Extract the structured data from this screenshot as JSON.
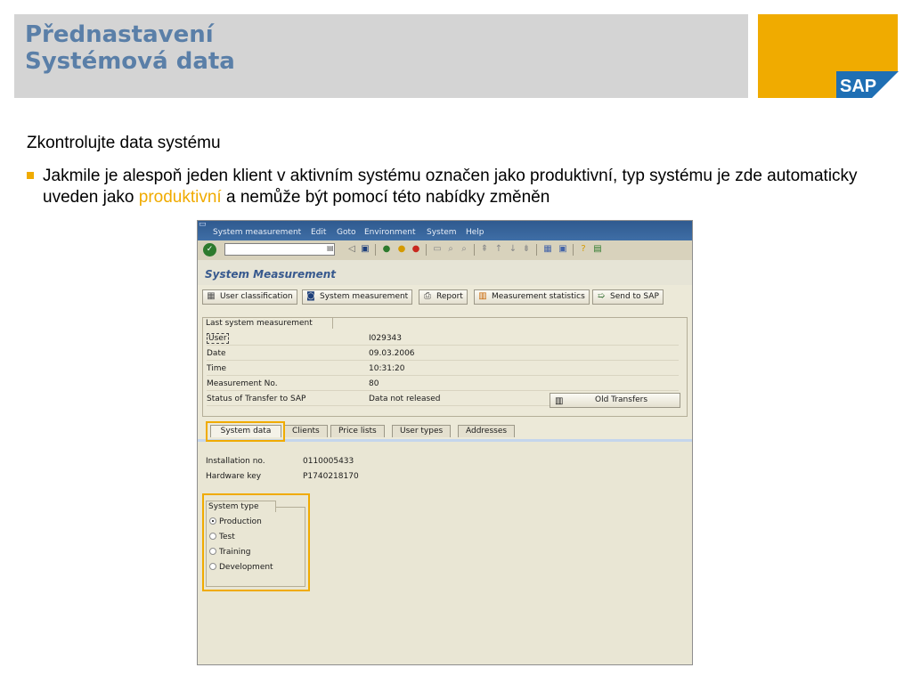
{
  "slide": {
    "title_line1": "Přednastavení",
    "title_line2": "Systémová data",
    "subheading": "Zkontrolujte data systému",
    "bullet_before": "Jakmile je alespoň jeden klient v aktivním systému označen jako produktivní, typ systému je zde automaticky uveden jako ",
    "bullet_highlight": "produktivní",
    "bullet_after": " a nemůže být pomocí této nabídky změněn",
    "logo_text": "SAP",
    "colors": {
      "accent": "#f0ab00",
      "title": "#5a7fa8",
      "header_bg": "#d4d4d4"
    }
  },
  "sap_window": {
    "menu": [
      "System measurement",
      "Edit",
      "Goto",
      "Environment",
      "System",
      "Help"
    ],
    "toolbar_icons": [
      "enter-icon",
      "command-field",
      "back-icon",
      "save-icon",
      "back-nav-icon",
      "exit-icon",
      "cancel-icon",
      "print-icon",
      "find-icon",
      "find-next-icon",
      "first-page-icon",
      "prev-page-icon",
      "next-page-icon",
      "last-page-icon",
      "new-session-icon",
      "shortcut-icon",
      "help-icon",
      "layout-icon"
    ],
    "screen_title": "System Measurement",
    "app_buttons": [
      {
        "label": "User classification",
        "icon": "grid-icon"
      },
      {
        "label": "System measurement",
        "icon": "measure-icon"
      },
      {
        "label": "Report",
        "icon": "print-icon"
      },
      {
        "label": "Measurement statistics",
        "icon": "chart-icon"
      },
      {
        "label": "Send to SAP",
        "icon": "send-icon"
      }
    ],
    "last_measurement": {
      "group_title": "Last system measurement",
      "rows": [
        {
          "label": "User",
          "value": "I029343"
        },
        {
          "label": "Date",
          "value": "09.03.2006"
        },
        {
          "label": "Time",
          "value": "10:31:20"
        },
        {
          "label": "Measurement No.",
          "value": "80"
        },
        {
          "label": "Status of Transfer to SAP",
          "value": "Data not released"
        }
      ],
      "old_transfers_label": "Old Transfers"
    },
    "tabs": [
      "System data",
      "Clients",
      "Price lists",
      "User types",
      "Addresses"
    ],
    "active_tab": "System data",
    "system_data": {
      "installation_label": "Installation no.",
      "installation_value": "0110005433",
      "hardware_label": "Hardware key",
      "hardware_value": "P1740218170"
    },
    "system_type": {
      "group_title": "System type",
      "options": [
        "Production",
        "Test",
        "Training",
        "Development"
      ],
      "selected": "Production"
    }
  }
}
